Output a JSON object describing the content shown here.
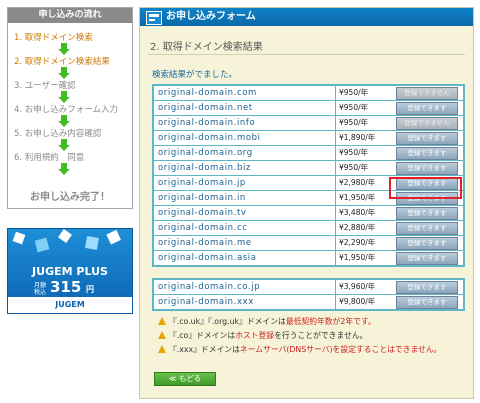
{
  "sidebar": {
    "title": "申し込みの流れ",
    "steps": [
      {
        "label": "1. 取得ドメイン検索",
        "active": true
      },
      {
        "label": "2. 取得ドメイン検索結果",
        "active": true
      },
      {
        "label": "3. ユーザー確認",
        "active": false
      },
      {
        "label": "4. お申し込みフォーム入力",
        "active": false
      },
      {
        "label": "5. お申し込み内容確認",
        "active": false
      },
      {
        "label": "6. 利用規約　同意",
        "active": false
      }
    ],
    "done": "お申し込み完了！"
  },
  "ad": {
    "brand": "JUGEM PLUS",
    "monthly": "月額 税込",
    "price": "315",
    "yen": "円",
    "logo": "JUGEM"
  },
  "main": {
    "title": "お申し込みフォーム",
    "section_title": "2. 取得ドメイン検索結果",
    "notice": "検索結果がでました。"
  },
  "results": [
    {
      "domain": "original-domain.com",
      "price": "¥950/年",
      "button": "登録できません",
      "available": false
    },
    {
      "domain": "original-domain.net",
      "price": "¥950/年",
      "button": "登録できます",
      "available": true
    },
    {
      "domain": "original-domain.info",
      "price": "¥950/年",
      "button": "登録できません",
      "available": false
    },
    {
      "domain": "original-domain.mobi",
      "price": "¥1,890/年",
      "button": "登録できます",
      "available": true
    },
    {
      "domain": "original-domain.org",
      "price": "¥950/年",
      "button": "登録できます",
      "available": true
    },
    {
      "domain": "original-domain.biz",
      "price": "¥950/年",
      "button": "登録できます",
      "available": true
    },
    {
      "domain": "original-domain.jp",
      "price": "¥2,980/年",
      "button": "登録できます",
      "available": true
    },
    {
      "domain": "original-domain.in",
      "price": "¥1,950/年",
      "button": "登録できます",
      "available": true
    },
    {
      "domain": "original-domain.tv",
      "price": "¥3,480/年",
      "button": "登録できます",
      "available": true
    },
    {
      "domain": "original-domain.cc",
      "price": "¥2,880/年",
      "button": "登録できます",
      "available": true
    },
    {
      "domain": "original-domain.me",
      "price": "¥2,290/年",
      "button": "登録できます",
      "available": true
    },
    {
      "domain": "original-domain.asia",
      "price": "¥1,950/年",
      "button": "登録できます",
      "available": true
    }
  ],
  "results2": [
    {
      "domain": "original-domain.co.jp",
      "price": "¥3,960/年",
      "button": "登録できます",
      "available": true
    },
    {
      "domain": "original-domain.xxx",
      "price": "¥9,800/年",
      "button": "登録できます",
      "available": true
    }
  ],
  "notes": [
    {
      "pre": "『.co.uk』『.org.uk』ドメインは",
      "red": "最低契約年数が2年です。",
      "post": ""
    },
    {
      "pre": "『.co』ドメインは",
      "red": "ホスト登録",
      "post": "を行うことができません。"
    },
    {
      "pre": "『.xxx』ドメインは",
      "red": "ネームサーバ(DNSサーバ)を設定することはできません。",
      "post": ""
    }
  ],
  "back_button": "≪ もどる",
  "colors": {
    "header_blue": "#0f82c8",
    "panel_bg": "#f6f3d8",
    "highlight_red": "#e0202a",
    "arrow_green": "#44bb22"
  }
}
